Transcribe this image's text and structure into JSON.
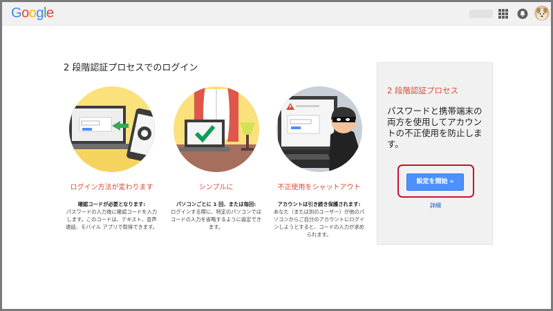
{
  "header": {
    "logo": "Google",
    "apps_icon": "apps-grid-icon",
    "notifications_icon": "bell-icon"
  },
  "page_title": "2 段階認証プロセスでのログイン",
  "features": [
    {
      "icon": "laptop-phone-illustration",
      "title": "ログイン方法が変わります",
      "desc_bold": "確認コードが必要となります:",
      "desc": "パスワードの入力後に確認コードを入力します。このコードは、テキスト、音声通話、モバイル アプリで取得できます。"
    },
    {
      "icon": "laptop-checkmark-illustration",
      "title": "シンプルに",
      "desc_bold": "パソコンごとに 1 回、または毎回:",
      "desc": "ログインする際に、特定のパソコンではコードの入力を省略するように設定できます。"
    },
    {
      "icon": "thief-illustration",
      "title": "不正使用をシャットアウト",
      "desc_bold": "アカウントは引き続き保護されます:",
      "desc": "あなた（または別のユーザー）が他のパソコンからご自分のアカウントにログインしようとすると、コードの入力が求められます。"
    }
  ],
  "panel": {
    "title": "2 段階認証プロセス",
    "text": "パスワードと携帯端末の両方を使用してアカウントの不正使用を防止します。",
    "start_button": "設定を開始 »",
    "details_link": "詳細"
  },
  "colors": {
    "accent_red": "#dd4b39",
    "button_blue": "#4d90fe",
    "link_blue": "#1155cc",
    "highlight": "#c8102e",
    "illustration_yellow": "#fbe17c"
  }
}
